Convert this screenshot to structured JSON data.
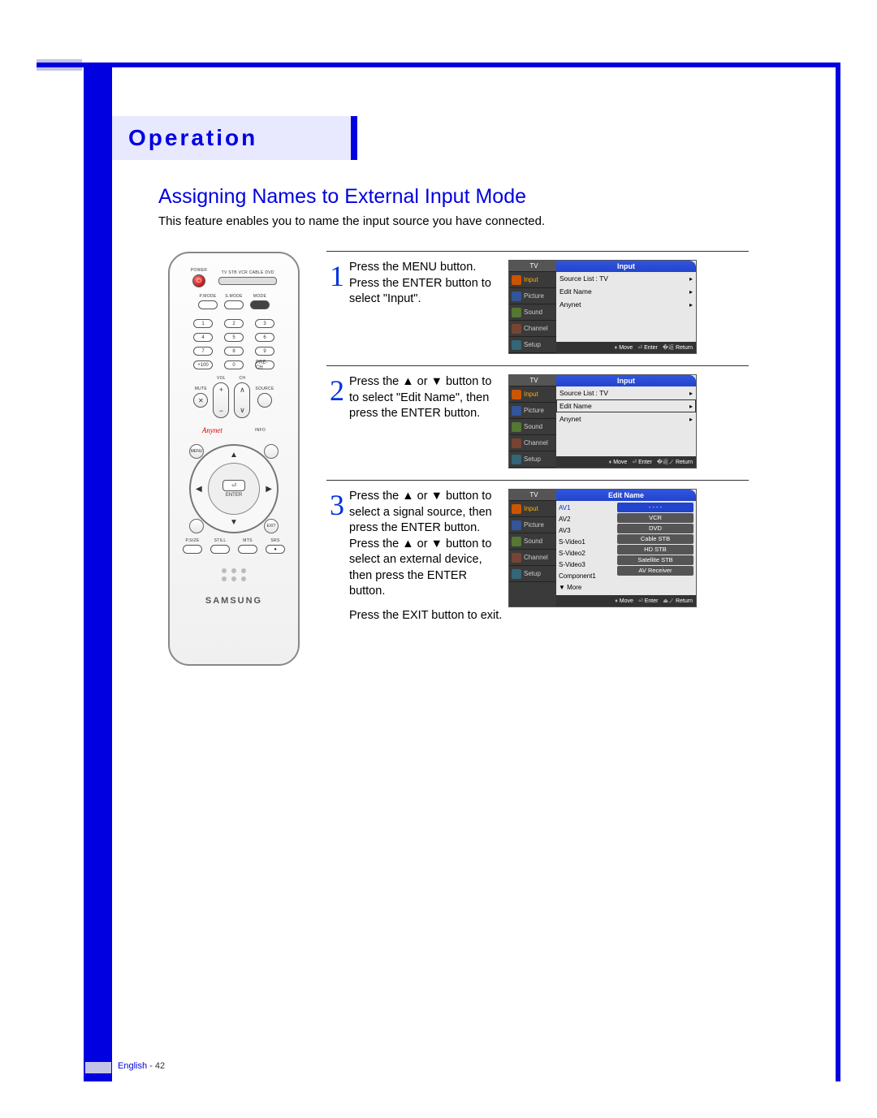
{
  "header": {
    "section": "Operation"
  },
  "subtitle": "Assigning Names to External Input Mode",
  "description": "This feature enables you to name the input source you have connected.",
  "remote": {
    "power_label": "POWER",
    "selector_labels": "TV  STB  VCR  CABLE  DVD",
    "mode_row": {
      "p_mode": "P.MODE",
      "s_mode": "S.MODE",
      "mode": "MODE"
    },
    "numbers": [
      "1",
      "2",
      "3",
      "4",
      "5",
      "6",
      "7",
      "8",
      "9"
    ],
    "plus100": "+100",
    "zero": "0",
    "pre_ch": "PRE-CH",
    "vol": "VOL",
    "ch": "CH",
    "mute": "MUTE",
    "source": "SOURCE",
    "anynet": "Anynet",
    "info": "INFO",
    "dpad": {
      "enter_icon": "⏎",
      "enter": "ENTER",
      "up": "▲",
      "down": "▼",
      "left": "◀",
      "right": "▶",
      "menu": "MENU",
      "exit": "EXIT"
    },
    "bottom": {
      "psize": "P.SIZE",
      "still": "STILL",
      "mts": "MTS",
      "srs": "SRS",
      "rec": "●"
    },
    "brand": "SAMSUNG"
  },
  "steps": [
    {
      "num": "1",
      "text": "Press the MENU button.\nPress the ENTER button to select \"Input\".",
      "osd": {
        "title": "Input",
        "tabs": [
          "Input",
          "Picture",
          "Sound",
          "Channel",
          "Setup"
        ],
        "items": [
          {
            "label": "Source List",
            "value": ": TV",
            "hl": false
          },
          {
            "label": "Edit Name",
            "value": "",
            "hl": false
          },
          {
            "label": "Anynet",
            "value": "",
            "hl": false
          }
        ],
        "footer": [
          "Move",
          "Enter",
          "Return"
        ]
      }
    },
    {
      "num": "2",
      "text": "Press the ▲ or ▼ button to to select \"Edit Name\", then press the ENTER button.",
      "osd": {
        "title": "Input",
        "tabs": [
          "Input",
          "Picture",
          "Sound",
          "Channel",
          "Setup"
        ],
        "items": [
          {
            "label": "Source List",
            "value": ": TV",
            "hl": false
          },
          {
            "label": "Edit Name",
            "value": "",
            "hl": true
          },
          {
            "label": "Anynet",
            "value": "",
            "hl": false
          }
        ],
        "footer": [
          "Move",
          "Enter",
          "Return"
        ]
      }
    },
    {
      "num": "3",
      "text_a": "Press the ▲ or ▼ button to select a signal source, then press the ENTER button.\nPress the ▲ or ▼ button to select an external device, then press the ENTER button.",
      "text_b": "Press the EXIT button to exit.",
      "osd": {
        "title": "Edit Name",
        "tabs": [
          "Input",
          "Picture",
          "Sound",
          "Channel",
          "Setup"
        ],
        "sources": [
          "AV1",
          "AV2",
          "AV3",
          "S-Video1",
          "S-Video2",
          "S-Video3",
          "Component1",
          "▼ More"
        ],
        "devices": [
          "- - - -",
          "VCR",
          "DVD",
          "Cable STB",
          "HD STB",
          "Satellite STB",
          "AV Receiver"
        ],
        "footer": [
          "Move",
          "Enter",
          "Return"
        ]
      }
    }
  ],
  "footer": {
    "language": "English",
    "page": "42"
  }
}
